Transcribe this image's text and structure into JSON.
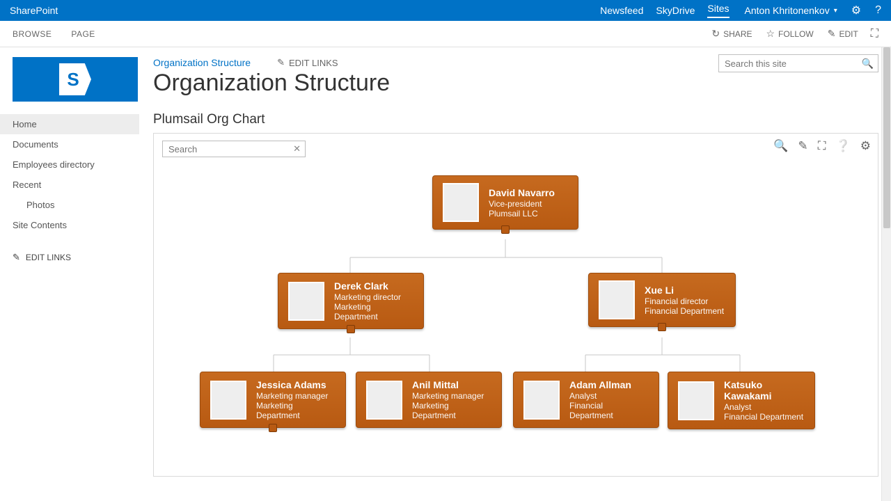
{
  "suite": {
    "brand": "SharePoint",
    "links": [
      "Newsfeed",
      "SkyDrive",
      "Sites"
    ],
    "active_link_index": 2,
    "user": "Anton Khritonenkov"
  },
  "ribbon": {
    "tabs": [
      "BROWSE",
      "PAGE"
    ],
    "actions": {
      "share": "SHARE",
      "follow": "FOLLOW",
      "edit": "EDIT"
    }
  },
  "sidebar": {
    "items": [
      {
        "label": "Home",
        "active": true
      },
      {
        "label": "Documents"
      },
      {
        "label": "Employees directory"
      },
      {
        "label": "Recent"
      },
      {
        "label": "Photos",
        "indent": true
      },
      {
        "label": "Site Contents"
      }
    ],
    "edit_links": "EDIT LINKS"
  },
  "header": {
    "crumb": "Organization Structure",
    "edit_links": "EDIT LINKS",
    "title": "Organization Structure",
    "site_search_placeholder": "Search this site"
  },
  "webpart": {
    "title": "Plumsail Org Chart",
    "search_placeholder": "Search"
  },
  "org": {
    "root": {
      "name": "David Navarro",
      "title": "Vice-president",
      "dept": "Plumsail LLC"
    },
    "level2": [
      {
        "name": "Derek Clark",
        "title": "Marketing director",
        "dept": "Marketing Department"
      },
      {
        "name": "Xue Li",
        "title": "Financial director",
        "dept": "Financial Department"
      }
    ],
    "level3a": [
      {
        "name": "Jessica Adams",
        "title": "Marketing manager",
        "dept": "Marketing Department"
      },
      {
        "name": "Anil Mittal",
        "title": "Marketing manager",
        "dept": "Marketing Department"
      }
    ],
    "level3b": [
      {
        "name": "Adam Allman",
        "title": "Analyst",
        "dept": "Financial Department"
      },
      {
        "name": "Katsuko Kawakami",
        "title": "Analyst",
        "dept": "Financial Department"
      }
    ]
  }
}
